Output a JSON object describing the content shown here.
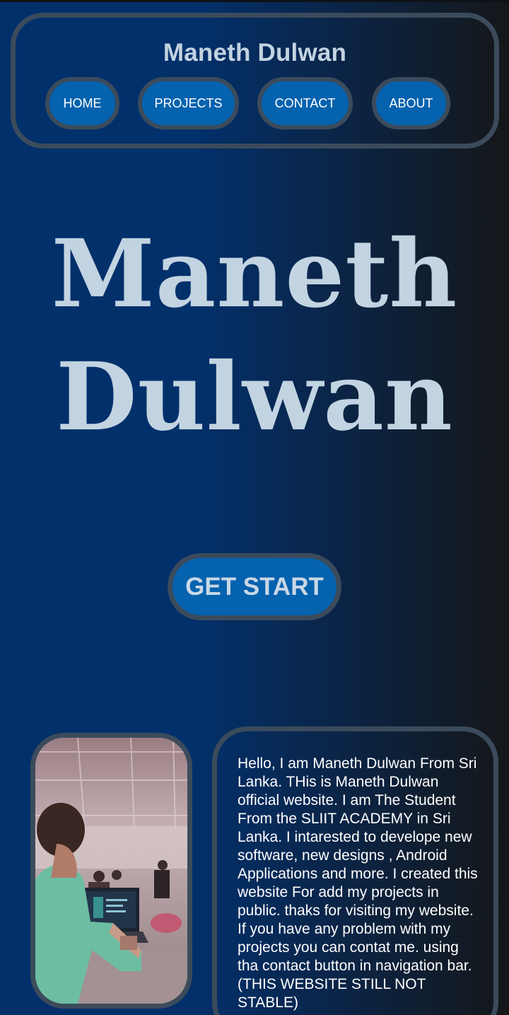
{
  "header": {
    "title": "Maneth Dulwan",
    "nav": {
      "home": "HOME",
      "projects": "PROJECTS",
      "contact": "CONTACT",
      "about": "ABOUT"
    }
  },
  "hero": {
    "line1": "Maneth",
    "line2": "Dulwan",
    "cta_label": "GET START"
  },
  "about": {
    "text": "Hello, I am Maneth Dulwan From Sri Lanka. THis is Maneth Dulwan official website. I am The Student From the SLIIT ACADEMY in Sri Lanka. I intarested to develope new software, new designs , Android Applications and more. I created this website For add my projects in public. thaks for visiting my website. If you have any problem with my projects you can contat me. using tha contact button in navigation bar. (THIS WEBSITE STILL NOT STABLE)"
  },
  "colors": {
    "background_left": "#02306b",
    "background_right": "#151719",
    "button_fill": "#0562ae",
    "border": "#3b4b5c",
    "heading_text": "#c2d3e1"
  }
}
